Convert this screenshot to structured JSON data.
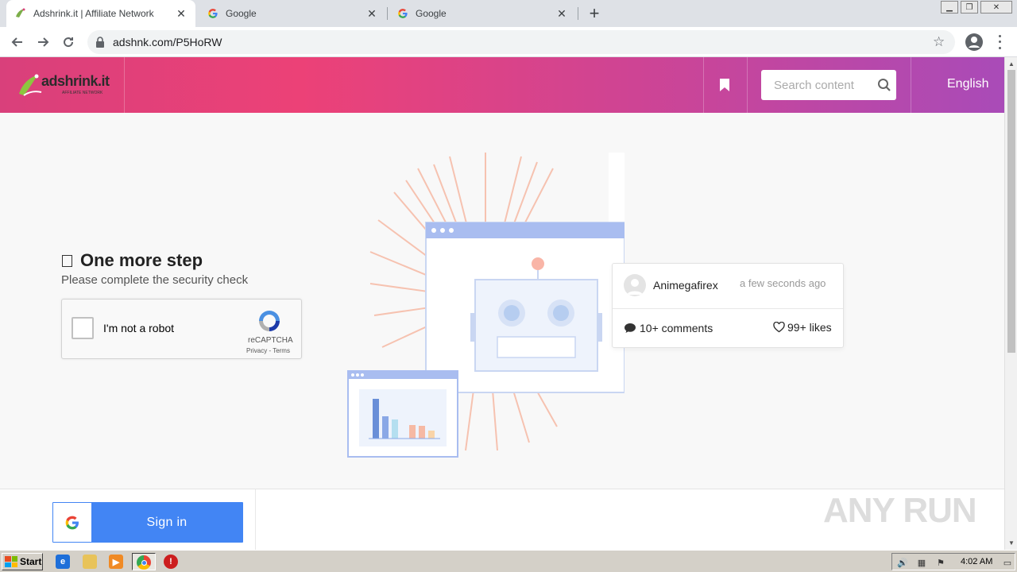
{
  "browser": {
    "tabs": [
      {
        "title": "Adshrink.it | Affiliate Network",
        "active": true,
        "icon": "adshrink-favicon"
      },
      {
        "title": "Google",
        "active": false,
        "icon": "google-favicon"
      },
      {
        "title": "Google",
        "active": false,
        "icon": "google-favicon"
      }
    ],
    "url": "adshnk.com/P5HoRW"
  },
  "header": {
    "logo_text": "adshrink.it",
    "logo_sub": "AFFILIATE NETWORK",
    "search_placeholder": "Search content",
    "language": "English"
  },
  "main": {
    "step_title": "One more step",
    "step_subtitle": "Please complete the security check",
    "captcha": {
      "label": "I'm not a robot",
      "brand": "reCAPTCHA",
      "terms": "Privacy - Terms"
    },
    "card": {
      "author": "Animegafirex",
      "time": "a few seconds ago",
      "comments": "10+ comments",
      "likes": "99+ likes"
    }
  },
  "footer": {
    "signin_label": "Sign in",
    "watermark": "ANY RUN"
  },
  "taskbar": {
    "start_label": "Start",
    "clock": "4:02 AM"
  },
  "colors": {
    "header_start": "#d9407b",
    "header_end": "#a94bb8",
    "signin_blue": "#4285f4"
  }
}
